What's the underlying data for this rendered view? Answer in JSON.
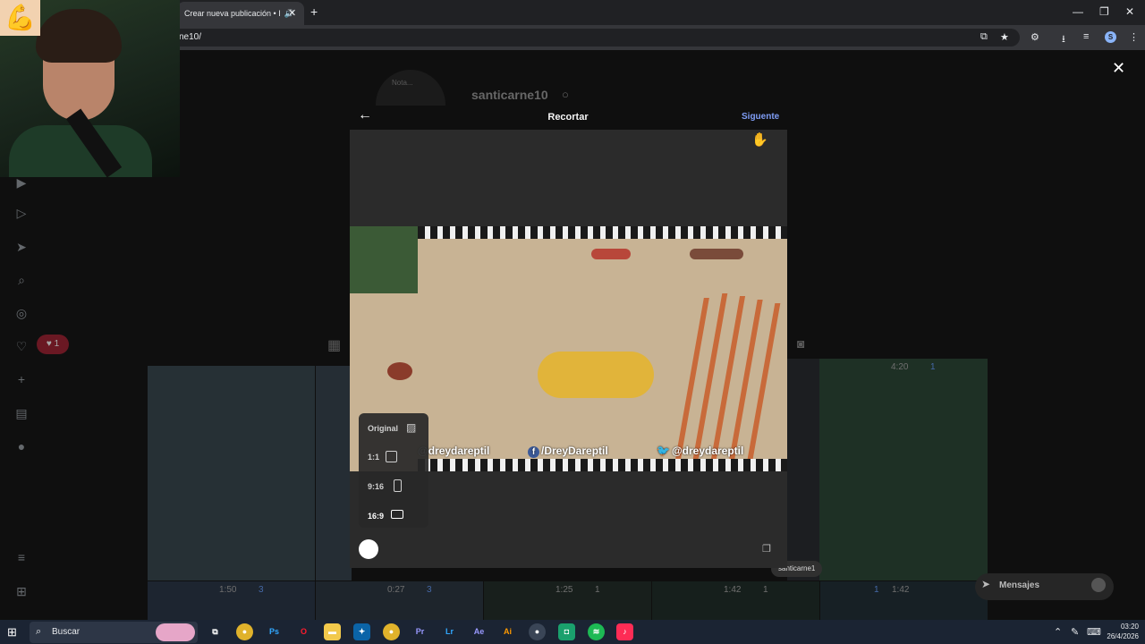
{
  "browser": {
    "tab_title": "Crear nueva publicación • I",
    "url": "ne10/"
  },
  "instagram": {
    "profile_name": "santicarne10",
    "notes_label": "Nota...",
    "notification_count": "1",
    "messages_label": "Mensajes",
    "chip_label": "santicarne1",
    "thumbnails": [
      {
        "duration": "1:50",
        "badge": "3"
      },
      {
        "duration": "0:27",
        "badge": "3"
      },
      {
        "duration": "1:25",
        "badge": "1"
      },
      {
        "duration": "1:42",
        "badge": "1"
      },
      {
        "duration": "1:42",
        "badge": "1"
      },
      {
        "duration": "4:20",
        "badge": "1"
      }
    ]
  },
  "modal": {
    "title": "Recortar",
    "next_label": "Siguente",
    "ratios": [
      {
        "label": "Original"
      },
      {
        "label": "1:1"
      },
      {
        "label": "9:16"
      },
      {
        "label": "16:9"
      }
    ],
    "video_overlays": {
      "instagram": "@dreydareptil",
      "facebook": "/DreyDareptil",
      "twitter": "@dreydareptil"
    }
  },
  "taskbar": {
    "search_label": "Buscar",
    "time": "03:20",
    "date": "26/4/2026",
    "apps": [
      {
        "label": "Ps",
        "color": "#0b2340"
      },
      {
        "label": "Pr",
        "color": "#1c0b3b"
      },
      {
        "label": "Lr",
        "color": "#0b2a3f"
      },
      {
        "label": "Ae",
        "color": "#1c0b3b"
      },
      {
        "label": "Ai",
        "color": "#3a1f05"
      }
    ]
  }
}
